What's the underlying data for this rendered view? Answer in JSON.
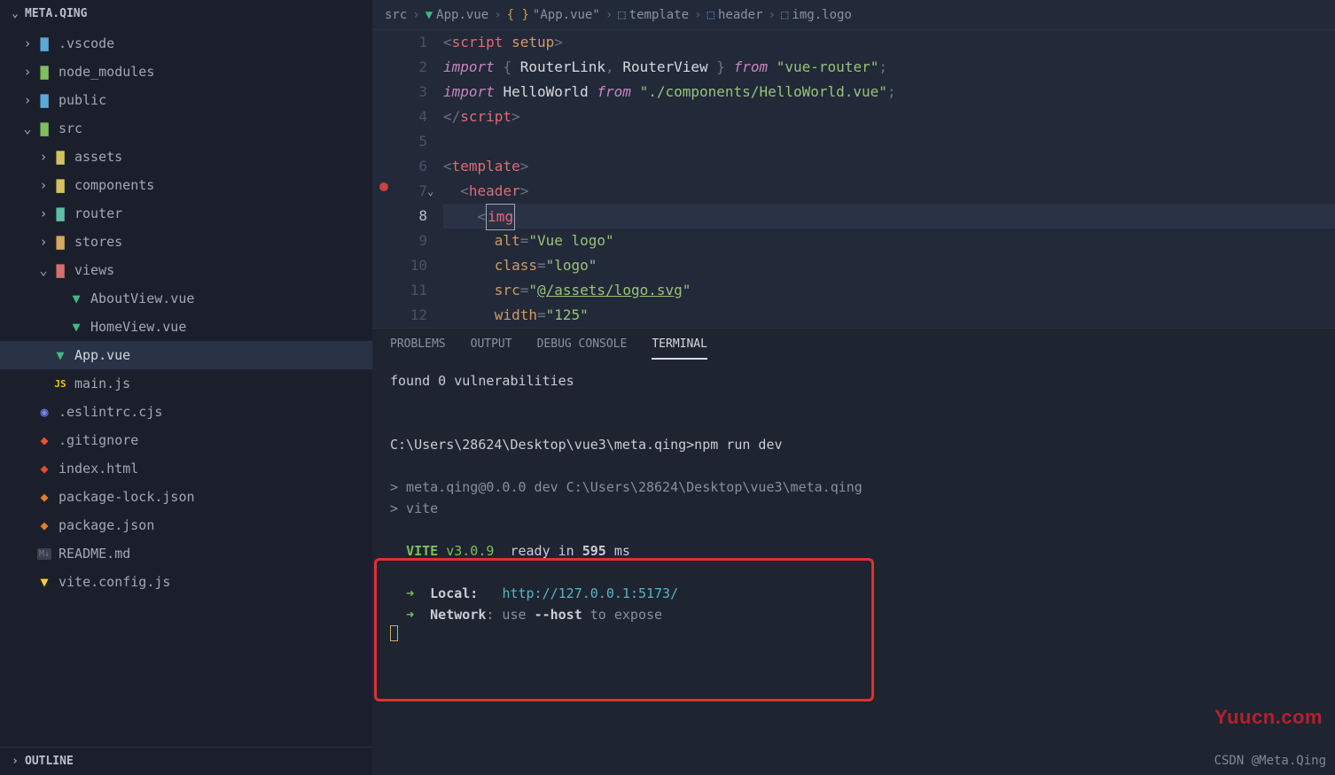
{
  "sidebar": {
    "header": "META.QING",
    "outline": "OUTLINE",
    "tree": [
      {
        "depth": 0,
        "label": ".vscode",
        "chev": "›",
        "icon": "folder-b",
        "interact": true
      },
      {
        "depth": 0,
        "label": "node_modules",
        "chev": "›",
        "icon": "folder-g",
        "interact": true
      },
      {
        "depth": 0,
        "label": "public",
        "chev": "›",
        "icon": "folder-b",
        "interact": true
      },
      {
        "depth": 0,
        "label": "src",
        "chev": "⌄",
        "icon": "folder-g",
        "interact": true
      },
      {
        "depth": 1,
        "label": "assets",
        "chev": "›",
        "icon": "folder-y",
        "interact": true
      },
      {
        "depth": 1,
        "label": "components",
        "chev": "›",
        "icon": "folder-y",
        "interact": true
      },
      {
        "depth": 1,
        "label": "router",
        "chev": "›",
        "icon": "folder-t",
        "interact": true
      },
      {
        "depth": 1,
        "label": "stores",
        "chev": "›",
        "icon": "folder",
        "interact": true
      },
      {
        "depth": 1,
        "label": "views",
        "chev": "⌄",
        "icon": "folder-r",
        "interact": true
      },
      {
        "depth": 2,
        "label": "AboutView.vue",
        "chev": "",
        "icon": "vue",
        "interact": true
      },
      {
        "depth": 2,
        "label": "HomeView.vue",
        "chev": "",
        "icon": "vue",
        "interact": true
      },
      {
        "depth": 1,
        "label": "App.vue",
        "chev": "",
        "icon": "vue",
        "interact": true,
        "active": true
      },
      {
        "depth": 1,
        "label": "main.js",
        "chev": "",
        "icon": "js",
        "interact": true
      },
      {
        "depth": 0,
        "label": ".eslintrc.cjs",
        "chev": "",
        "icon": "eslint",
        "interact": true
      },
      {
        "depth": 0,
        "label": ".gitignore",
        "chev": "",
        "icon": "git",
        "interact": true
      },
      {
        "depth": 0,
        "label": "index.html",
        "chev": "",
        "icon": "html",
        "interact": true
      },
      {
        "depth": 0,
        "label": "package-lock.json",
        "chev": "",
        "icon": "json",
        "interact": true
      },
      {
        "depth": 0,
        "label": "package.json",
        "chev": "",
        "icon": "json",
        "interact": true
      },
      {
        "depth": 0,
        "label": "README.md",
        "chev": "",
        "icon": "md",
        "interact": true
      },
      {
        "depth": 0,
        "label": "vite.config.js",
        "chev": "",
        "icon": "vite",
        "interact": true
      }
    ]
  },
  "breadcrumb": [
    {
      "label": "src",
      "icon": ""
    },
    {
      "label": "App.vue",
      "icon": "vue"
    },
    {
      "label": "\"App.vue\"",
      "icon": "braces"
    },
    {
      "label": "template",
      "icon": "cube"
    },
    {
      "label": "header",
      "icon": "cube"
    },
    {
      "label": "img.logo",
      "icon": "cube"
    }
  ],
  "code": {
    "activeLine": 8,
    "lines": [
      {
        "n": 1,
        "html": "<span class='tk-bracket'>&lt;</span><span class='tk-tag'>script</span> <span class='tk-attr'>setup</span><span class='tk-bracket'>&gt;</span>"
      },
      {
        "n": 2,
        "html": "<span class='tk-keyword'>import</span> <span class='tk-bracket'>{</span> <span class='tk-ident'>RouterLink</span><span class='tk-bracket'>,</span> <span class='tk-ident'>RouterView</span> <span class='tk-bracket'>}</span> <span class='tk-keyword'>from</span> <span class='tk-string'>\"vue-router\"</span><span class='tk-bracket'>;</span>"
      },
      {
        "n": 3,
        "html": "<span class='tk-keyword'>import</span> <span class='tk-ident'>HelloWorld</span> <span class='tk-keyword'>from</span> <span class='tk-string'>\"./components/HelloWorld.vue\"</span><span class='tk-bracket'>;</span>"
      },
      {
        "n": 4,
        "html": "<span class='tk-bracket'>&lt;/</span><span class='tk-tag'>script</span><span class='tk-bracket'>&gt;</span>"
      },
      {
        "n": 5,
        "html": ""
      },
      {
        "n": 6,
        "html": "<span class='tk-bracket'>&lt;</span><span class='tk-tag'>template</span><span class='tk-bracket'>&gt;</span>"
      },
      {
        "n": 7,
        "html": "  <span class='tk-bracket'>&lt;</span><span class='tk-tag'>header</span><span class='tk-bracket'>&gt;</span>"
      },
      {
        "n": 8,
        "html": "    <span class='tk-bracket'>&lt;</span><span class='cursor-box'><span class='tk-tag'>img</span></span>",
        "active": true
      },
      {
        "n": 9,
        "html": "      <span class='tk-attr'>alt</span><span class='tk-bracket'>=</span><span class='tk-string'>\"Vue logo\"</span>"
      },
      {
        "n": 10,
        "html": "      <span class='tk-attr'>class</span><span class='tk-bracket'>=</span><span class='tk-string'>\"logo\"</span>"
      },
      {
        "n": 11,
        "html": "      <span class='tk-attr'>src</span><span class='tk-bracket'>=</span><span class='tk-string'>\"<span class='tk-link'>@/assets/logo.svg</span>\"</span>"
      },
      {
        "n": 12,
        "html": "      <span class='tk-attr'>width</span><span class='tk-bracket'>=</span><span class='tk-string'>\"125\"</span>"
      }
    ]
  },
  "panel": {
    "tabs": [
      {
        "label": "PROBLEMS",
        "active": false
      },
      {
        "label": "OUTPUT",
        "active": false
      },
      {
        "label": "DEBUG CONSOLE",
        "active": false
      },
      {
        "label": "TERMINAL",
        "active": true
      }
    ],
    "terminal": {
      "found": "found 0 vulnerabilities",
      "prompt": "C:\\Users\\28624\\Desktop\\vue3\\meta.qing>npm run dev",
      "script1": "> meta.qing@0.0.0 dev C:\\Users\\28624\\Desktop\\vue3\\meta.qing",
      "script2": "> vite",
      "vite_label": "VITE",
      "vite_ver": "v3.0.9",
      "ready1": "ready in",
      "ready_ms": "595",
      "ready2": "ms",
      "local_label": "Local:",
      "local_url": "http://127.0.0.1:5173/",
      "net_label": "Network",
      "net_rest": ": use",
      "net_host": "--host",
      "net_tail": "to expose"
    }
  },
  "watermark": "Yuucn.com",
  "csdn": "CSDN @Meta.Qing"
}
